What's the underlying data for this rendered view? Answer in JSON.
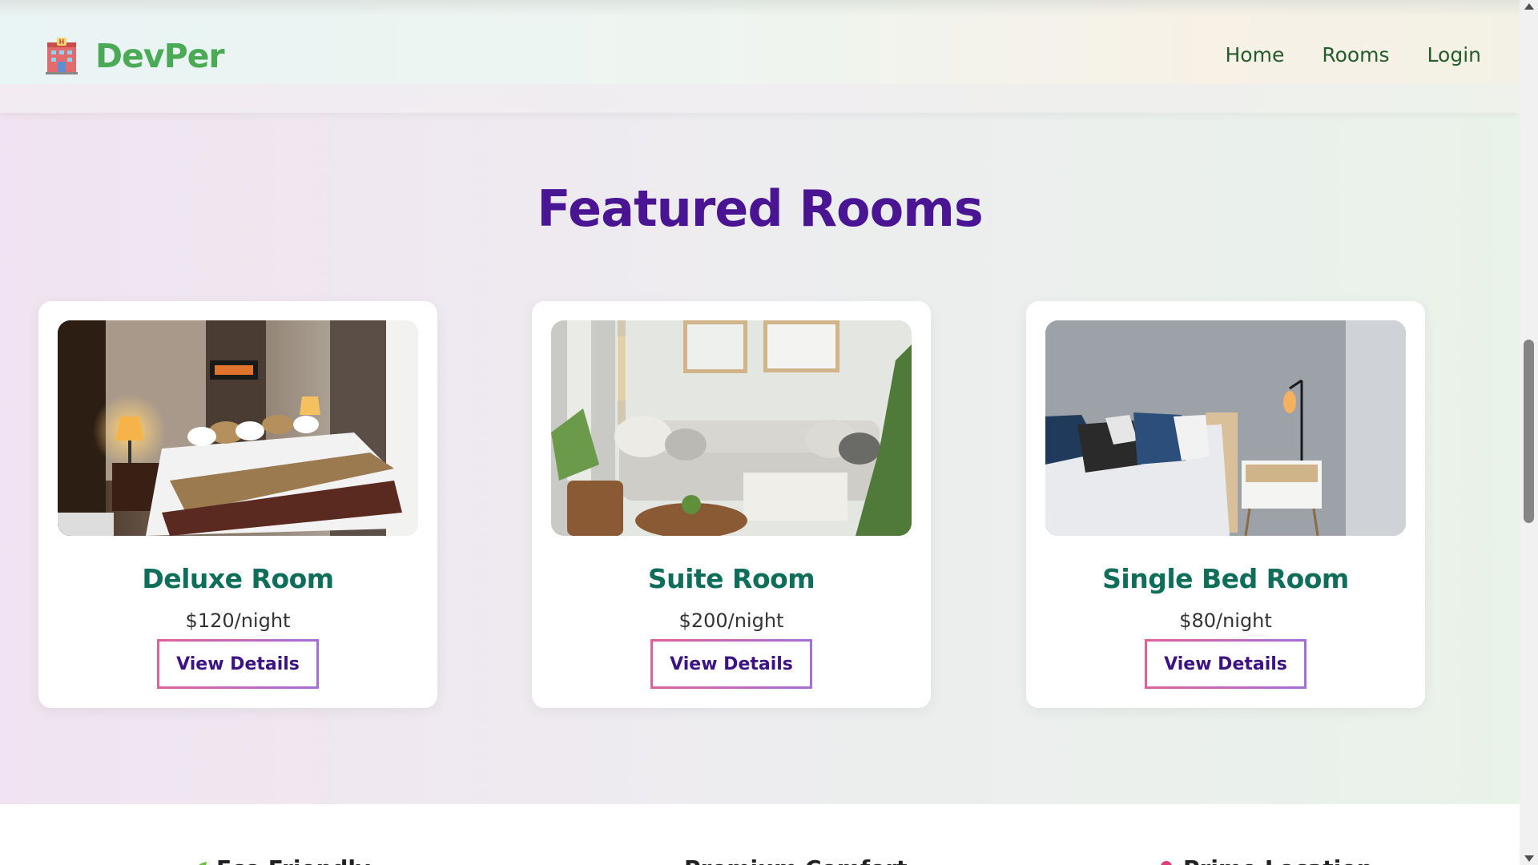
{
  "header": {
    "logo_text": "DevPer",
    "logo_icon": "hotel-icon",
    "nav": [
      "Home",
      "Rooms",
      "Login"
    ]
  },
  "main": {
    "title": "Featured Rooms",
    "rooms": [
      {
        "name": "Deluxe Room",
        "price": "$120/night",
        "button": "View Details",
        "image": "deluxe-bedroom-photo"
      },
      {
        "name": "Suite Room",
        "price": "$200/night",
        "button": "View Details",
        "image": "suite-living-room-photo"
      },
      {
        "name": "Single Bed Room",
        "price": "$80/night",
        "button": "View Details",
        "image": "single-bedroom-photo"
      }
    ]
  },
  "features": [
    {
      "label": "Eco Friendly",
      "icon": "leaf-icon"
    },
    {
      "label": "Premium Comfort",
      "icon": "bed-icon"
    },
    {
      "label": "Prime Location",
      "icon": "pin-icon"
    }
  ],
  "colors": {
    "brand_green": "#4aaa55",
    "nav_green": "#245c2c",
    "title_purple": "#4a1593",
    "room_title_teal": "#0e6e59",
    "button_text": "#3d1384",
    "button_border_start": "#e0609a",
    "button_border_end": "#a46fd6"
  }
}
